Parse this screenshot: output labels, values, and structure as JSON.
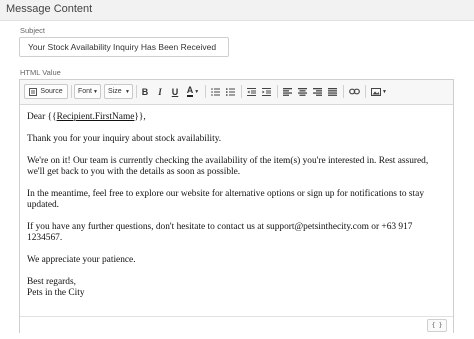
{
  "panel": {
    "title": "Message Content"
  },
  "subject": {
    "label": "Subject",
    "value": "Your Stock Availability Inquiry Has Been Received"
  },
  "html_value": {
    "label": "HTML Value"
  },
  "toolbar": {
    "source_label": "Source",
    "font_label": "Font",
    "size_label": "Size",
    "bold": "B",
    "italic": "I",
    "underline": "U",
    "font_color": "A"
  },
  "body": {
    "greeting_prefix": "Dear {{",
    "merge_tag": "Recipient.FirstName",
    "greeting_suffix": "}},",
    "p1": "Thank you for your inquiry about stock availability.",
    "p2": "We're on it! Our team is currently checking the availability of the item(s) you're interested in. Rest assured, we'll get back to you with the details as soon as possible.",
    "p3": "In the meantime, feel free to explore our website for alternative options or sign up for notifications to stay updated.",
    "p4": "If you have any further questions, don't hesitate to contact us at support@petsinthecity.com or +63 917 1234567.",
    "p5": "We appreciate your patience.",
    "closing": "Best regards,",
    "signature": "Pets in the City"
  },
  "statusbar": {
    "code_button": "{ }"
  }
}
